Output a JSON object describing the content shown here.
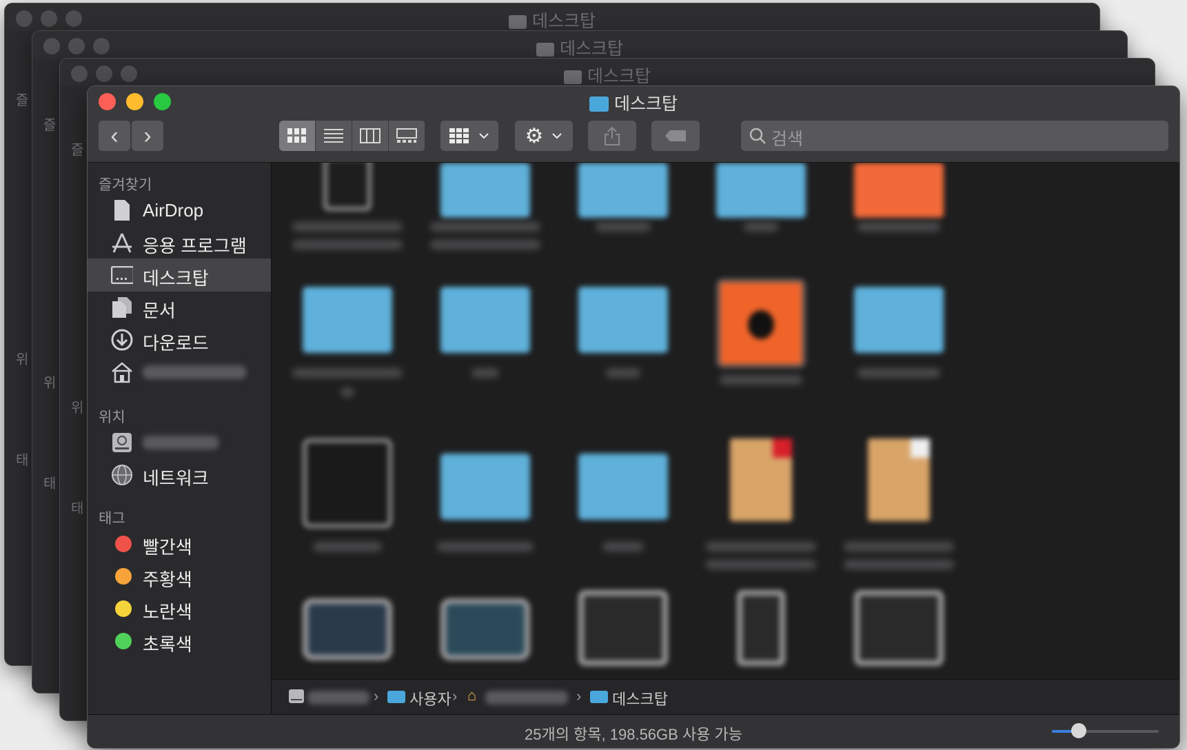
{
  "window": {
    "title": "데스크탑"
  },
  "background_windows": {
    "title": "데스크탑",
    "sidebar_peeks": [
      "즐",
      "위",
      "태"
    ]
  },
  "toolbar": {
    "back": "‹",
    "forward": "›",
    "view_modes": [
      "icon-view",
      "list-view",
      "column-view",
      "gallery-view"
    ],
    "active_view": "icon-view",
    "search_placeholder": "검색"
  },
  "sidebar": {
    "favorites_header": "즐겨찾기",
    "favorites": [
      {
        "label": "AirDrop",
        "icon": "airdrop-icon"
      },
      {
        "label": "응용 프로그램",
        "icon": "applications-icon"
      },
      {
        "label": "데스크탑",
        "icon": "desktop-icon",
        "selected": true
      },
      {
        "label": "문서",
        "icon": "documents-icon"
      },
      {
        "label": "다운로드",
        "icon": "downloads-icon"
      },
      {
        "label": "",
        "icon": "home-icon",
        "blurred": true
      }
    ],
    "locations_header": "위치",
    "locations": [
      {
        "label": "",
        "icon": "disk-icon",
        "blurred": true
      },
      {
        "label": "네트워크",
        "icon": "network-icon"
      }
    ],
    "tags_header": "태그",
    "tags": [
      {
        "label": "빨간색",
        "color": "#f0524a"
      },
      {
        "label": "주황색",
        "color": "#f5a33a"
      },
      {
        "label": "노란색",
        "color": "#f4d43a"
      },
      {
        "label": "초록색",
        "color": "#4fd15a"
      }
    ]
  },
  "pathbar": {
    "segments": [
      "",
      "사용자",
      "",
      "데스크탑"
    ],
    "separator": "›"
  },
  "status": {
    "text": "25개의 항목, 198.56GB 사용 가능",
    "icon_size_fraction": 0.25
  },
  "colors": {
    "accent": "#3a7fe0",
    "folder": "#5fb1db",
    "close": "#fe5f57",
    "minimize": "#febc2e",
    "zoom": "#28c840"
  }
}
